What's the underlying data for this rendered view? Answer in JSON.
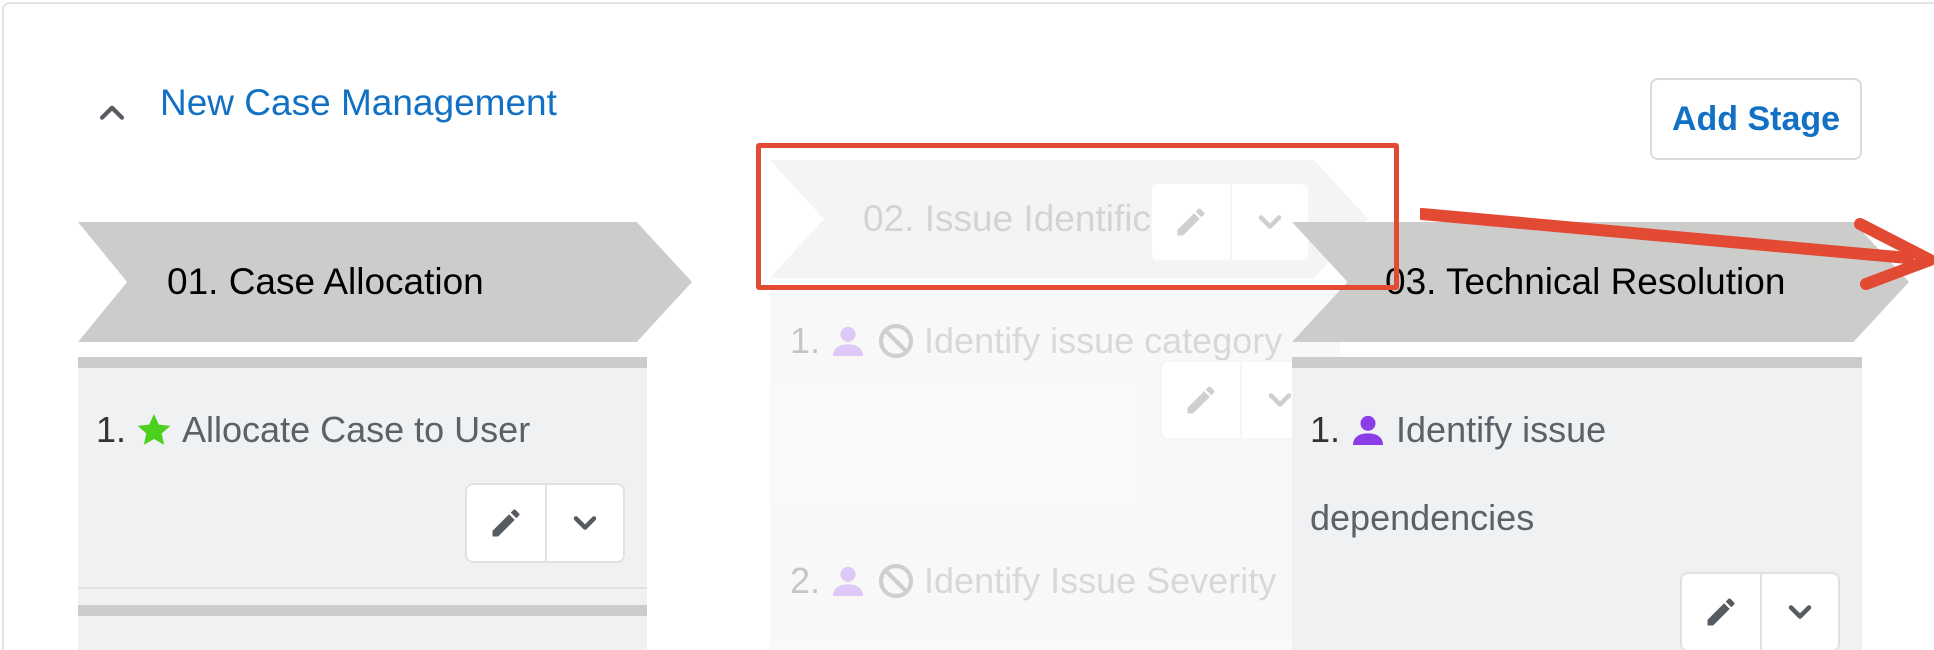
{
  "header": {
    "title": "New Case Management",
    "add_stage_label": "Add Stage"
  },
  "stages": [
    {
      "label": "01. Case Allocation",
      "activities": [
        {
          "num": "1.",
          "icon": "star-icon",
          "label": "Allocate Case to User"
        }
      ]
    },
    {
      "label": "02. Issue Identific",
      "activities": [
        {
          "num": "1.",
          "icon": "user-icon",
          "label": "Identify issue category"
        },
        {
          "num": "2.",
          "icon": "user-icon",
          "label": "Identify Issue Severity"
        }
      ]
    },
    {
      "label": "03. Technical Resolution",
      "activities": [
        {
          "num": "1.",
          "icon": "user-icon",
          "label": "Identify issue",
          "label_line2": "dependencies"
        }
      ]
    }
  ],
  "colors": {
    "accent": "#1271c4",
    "chevron": "#cccccb",
    "star": "#4cd01e",
    "user": "#8a3ee8",
    "annotation": "#e34a33"
  }
}
